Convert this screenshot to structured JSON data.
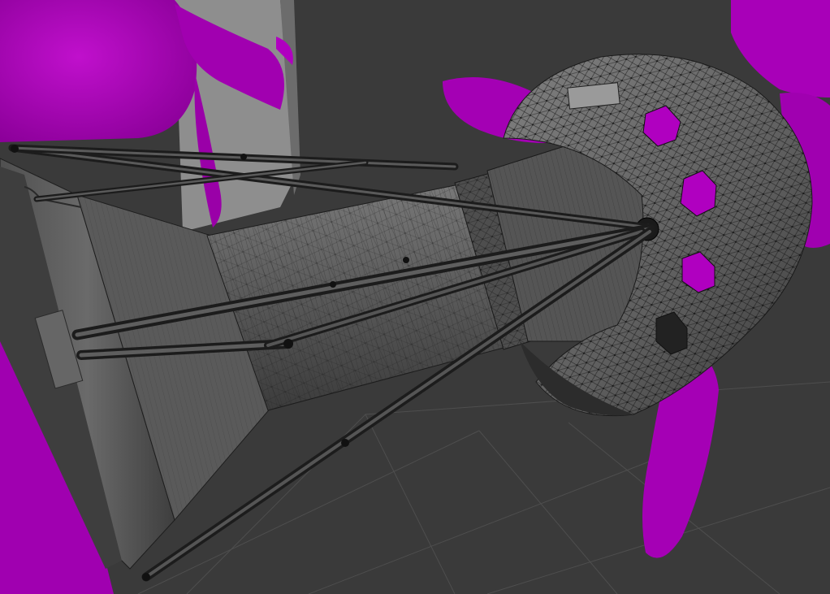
{
  "viewport": {
    "background_color": "#3a3a3a",
    "ground_grid_visible": true,
    "wireframe_overlay": true,
    "shading": "solid-gray-with-wire"
  },
  "colors": {
    "missing_texture": "#a800b4",
    "model_body": "#5e5e5e",
    "model_dark": "#2a2a2a",
    "wire": "#111111",
    "backdrop_panel": "#8c8c8c",
    "grid_line": "#4e4e4e"
  },
  "objects": [
    {
      "name": "engine-nacelle",
      "material": "gray-shaded"
    },
    {
      "name": "propeller-blades",
      "material": "missing-texture-magenta"
    },
    {
      "name": "strut-rods",
      "material": "dark-gray"
    },
    {
      "name": "backdrop-panel",
      "material": "light-gray"
    }
  ]
}
